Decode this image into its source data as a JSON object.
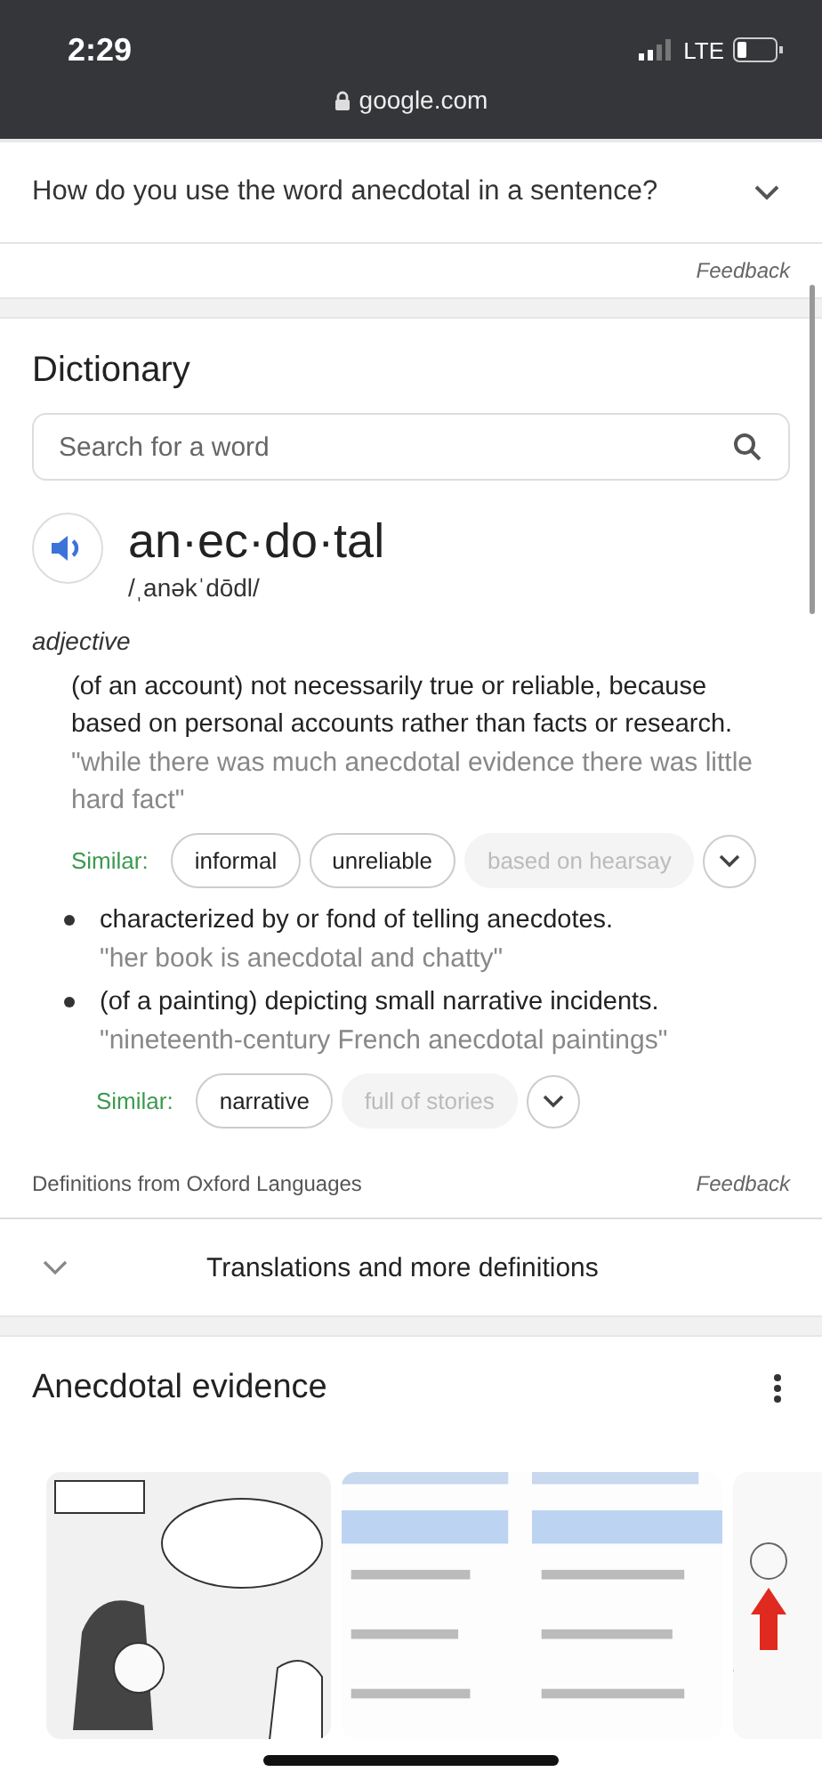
{
  "status_bar": {
    "time": "2:29",
    "network": "LTE"
  },
  "address_bar": {
    "url": "google.com"
  },
  "question": {
    "text": "How do you use the word anecdotal in a sentence?",
    "expanded": false
  },
  "feedback_top": "Feedback",
  "dictionary": {
    "title": "Dictionary",
    "search": {
      "placeholder": "Search for a word"
    },
    "word": "an·ec·do·tal",
    "phonetic": "/ˌanəkˈdōdl/",
    "part_of_speech": "adjective",
    "senses": [
      {
        "bullet": false,
        "definition": "(of an account) not necessarily true or reliable, because based on personal accounts rather than facts or research.",
        "example": "\"while there was much anecdotal evidence there was little hard fact\"",
        "similar_label": "Similar:",
        "similar": [
          {
            "label": "informal",
            "disabled": false
          },
          {
            "label": "unreliable",
            "disabled": false
          },
          {
            "label": "based on hearsay",
            "disabled": true
          }
        ]
      },
      {
        "bullet": true,
        "definition": "characterized by or fond of telling anecdotes.",
        "example": "\"her book is anecdotal and chatty\""
      },
      {
        "bullet": true,
        "definition": "(of a painting) depicting small narrative incidents.",
        "example": "\"nineteenth-century French anecdotal paintings\"",
        "similar_label": "Similar:",
        "similar": [
          {
            "label": "narrative",
            "disabled": false
          },
          {
            "label": "full of stories",
            "disabled": true
          }
        ]
      }
    ],
    "source": "Definitions from Oxford Languages",
    "feedback": "Feedback"
  },
  "translations": {
    "label": "Translations and more definitions",
    "expanded": false
  },
  "images_section": {
    "title": "Anecdotal evidence"
  }
}
